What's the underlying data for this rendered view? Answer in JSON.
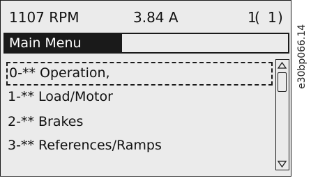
{
  "status": {
    "speed": "1107 RPM",
    "current": "3.84 A",
    "active_setup": "1",
    "edit_setup": "1"
  },
  "menu": {
    "title": "Main Menu",
    "items": [
      {
        "num": "0",
        "stars": "-**",
        "label": " Operation,"
      },
      {
        "num": "1",
        "stars": "-**",
        "label": " Load/Motor"
      },
      {
        "num": "2",
        "stars": "-**",
        "label": " Brakes"
      },
      {
        "num": "3",
        "stars": "-**",
        "label": " References/Ramps"
      }
    ],
    "selected_index": 0
  },
  "figure_code": "e30bp066.14",
  "icons": [
    "scroll-up-arrow-icon",
    "scroll-down-arrow-icon"
  ]
}
